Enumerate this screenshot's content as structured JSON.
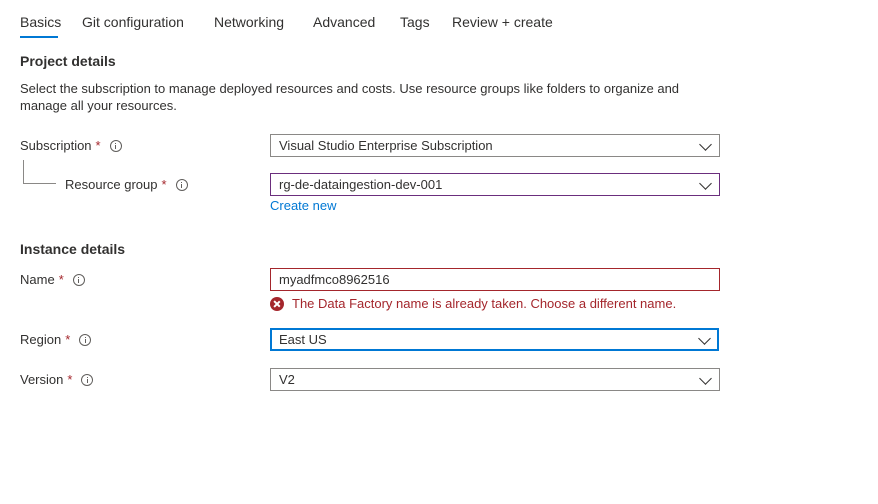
{
  "tabs": [
    {
      "label": "Basics",
      "active": true
    },
    {
      "label": "Git configuration"
    },
    {
      "label": "Networking"
    },
    {
      "label": "Advanced"
    },
    {
      "label": "Tags"
    },
    {
      "label": "Review + create"
    }
  ],
  "project": {
    "title": "Project details",
    "description": "Select the subscription to manage deployed resources and costs. Use resource groups like folders to organize and manage all your resources.",
    "subscription_label": "Subscription",
    "subscription_value": "Visual Studio Enterprise Subscription",
    "resource_group_label": "Resource group",
    "resource_group_value": "rg-de-dataingestion-dev-001",
    "create_new": "Create new"
  },
  "instance": {
    "title": "Instance details",
    "name_label": "Name",
    "name_value": "myadfmco8962516",
    "name_error": "The Data Factory name is already taken. Choose a different name.",
    "region_label": "Region",
    "region_value": "East US",
    "version_label": "Version",
    "version_value": "V2"
  },
  "required_mark": "*",
  "colors": {
    "accent": "#0078d4",
    "error": "#a4262c",
    "focus_purple": "#6b2e7d"
  }
}
